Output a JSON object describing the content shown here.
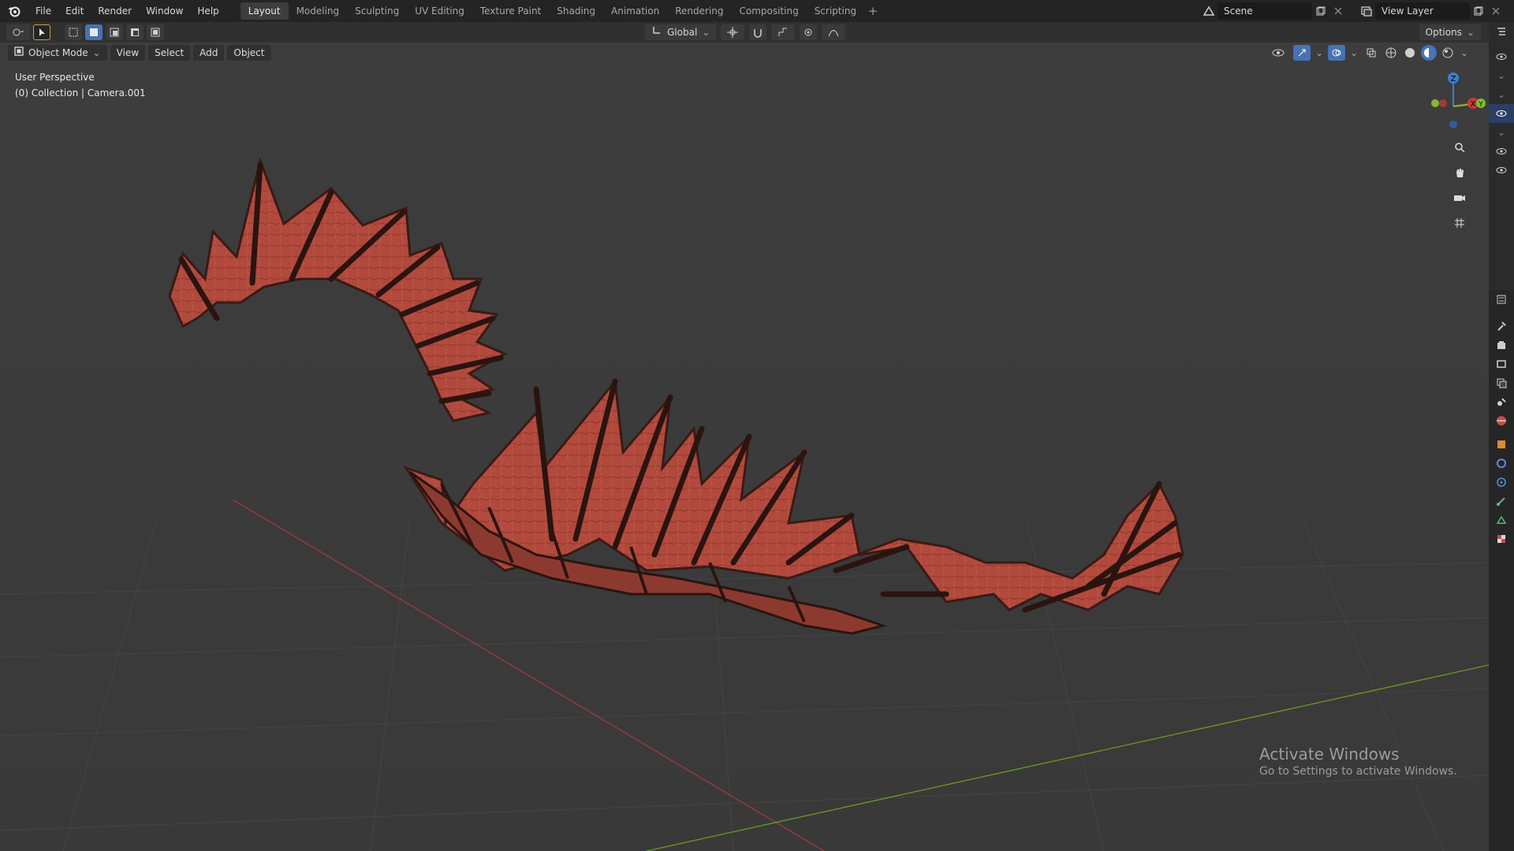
{
  "menu": {
    "items": [
      "File",
      "Edit",
      "Render",
      "Window",
      "Help"
    ]
  },
  "workspaces": {
    "tabs": [
      "Layout",
      "Modeling",
      "Sculpting",
      "UV Editing",
      "Texture Paint",
      "Shading",
      "Animation",
      "Rendering",
      "Compositing",
      "Scripting"
    ],
    "active": "Layout",
    "add_label": "+"
  },
  "scene": {
    "name": "Scene"
  },
  "view_layer": {
    "name": "View Layer"
  },
  "toolheader": {
    "orientation": "Global",
    "options_label": "Options"
  },
  "viewport": {
    "mode": "Object Mode",
    "menus": [
      "View",
      "Select",
      "Add",
      "Object"
    ],
    "perspective": "User Perspective",
    "collection_info": "(0) Collection | Camera.001",
    "gizmo_axes": {
      "x": "X",
      "y": "Y",
      "z": "Z"
    }
  },
  "watermark": {
    "title": "Activate Windows",
    "subtitle": "Go to Settings to activate Windows."
  },
  "colors": {
    "accent": "#4772b3",
    "axis_x": "#c83a3a",
    "axis_y": "#7fbf2a",
    "axis_z": "#3a7fd6",
    "wing_red": "#b34a3c"
  },
  "icons": {
    "outliner": [
      "eye-icon",
      "chevron-icon",
      "chevron-icon",
      "eye-icon",
      "chevron-icon",
      "eye-icon",
      "eye-icon"
    ],
    "properties": [
      "tool-icon",
      "render-icon",
      "output-icon",
      "view-layer-icon",
      "scene-icon",
      "world-icon",
      "object-icon",
      "modifier-icon",
      "physics-icon",
      "constraint-icon",
      "data-icon",
      "texture-icon"
    ]
  }
}
